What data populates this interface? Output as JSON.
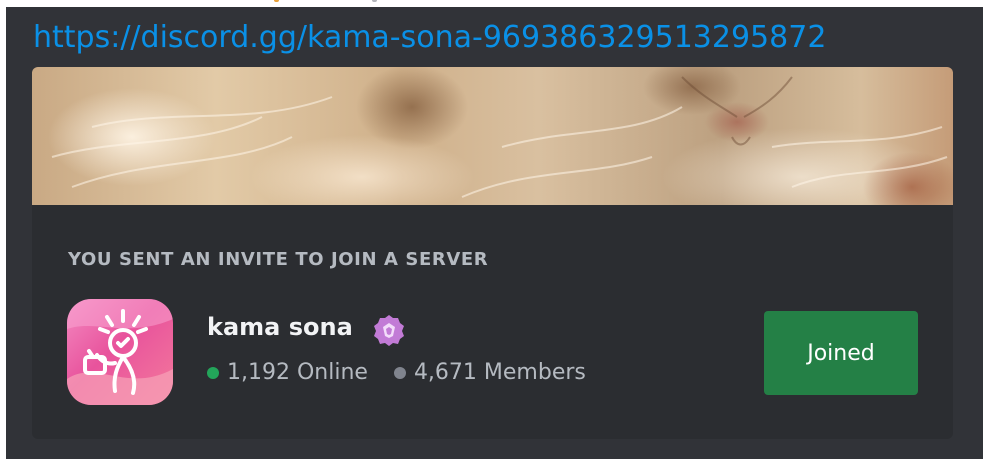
{
  "message": {
    "link_text": "https://discord.gg/kama-sona-969386329513295872"
  },
  "invite": {
    "heading": "YOU SENT AN INVITE TO JOIN A SERVER",
    "server_name": "kama sona",
    "online_count": "1,192 Online",
    "member_count": "4,671 Members",
    "button_label": "Joined",
    "badge_icon": "verified-badge-icon",
    "server_icon": "kama-sona-server-icon"
  },
  "colors": {
    "message_bg": "#313338",
    "embed_bg": "#2b2d31",
    "link": "#0a90e6",
    "online_dot": "#23a55a",
    "members_dot": "#80848e",
    "joined_button": "#248046",
    "badge": "#c27bd6"
  }
}
